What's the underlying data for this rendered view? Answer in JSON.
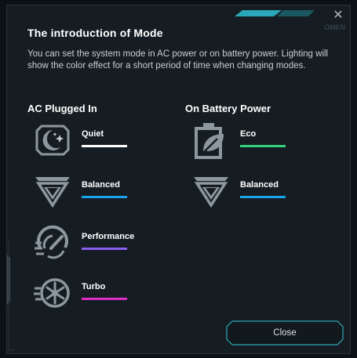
{
  "dialog": {
    "title": "The introduction of Mode",
    "brand": "OMEN",
    "description": "You can set the system mode in AC power or on battery power. Lighting will show the color effect for a short period of time when changing modes.",
    "close_label": "Close"
  },
  "ac": {
    "heading": "AC Plugged In",
    "modes": [
      {
        "label": "Quiet",
        "icon": "moon-stars-icon",
        "color": "#ffffff"
      },
      {
        "label": "Balanced",
        "icon": "balanced-chevron-icon",
        "color": "#1aa3e8"
      },
      {
        "label": "Performance",
        "icon": "speed-gauge-icon",
        "color": "#8a5cf0"
      },
      {
        "label": "Turbo",
        "icon": "turbo-fan-icon",
        "color": "#e02ec8"
      }
    ]
  },
  "battery": {
    "heading": "On Battery Power",
    "modes": [
      {
        "label": "Eco",
        "icon": "battery-leaf-icon",
        "color": "#35d07f"
      },
      {
        "label": "Balanced",
        "icon": "balanced-chevron-icon",
        "color": "#1aa3e8"
      }
    ]
  },
  "colors": {
    "background": "#161d22",
    "accent": "#2aa8b8"
  }
}
